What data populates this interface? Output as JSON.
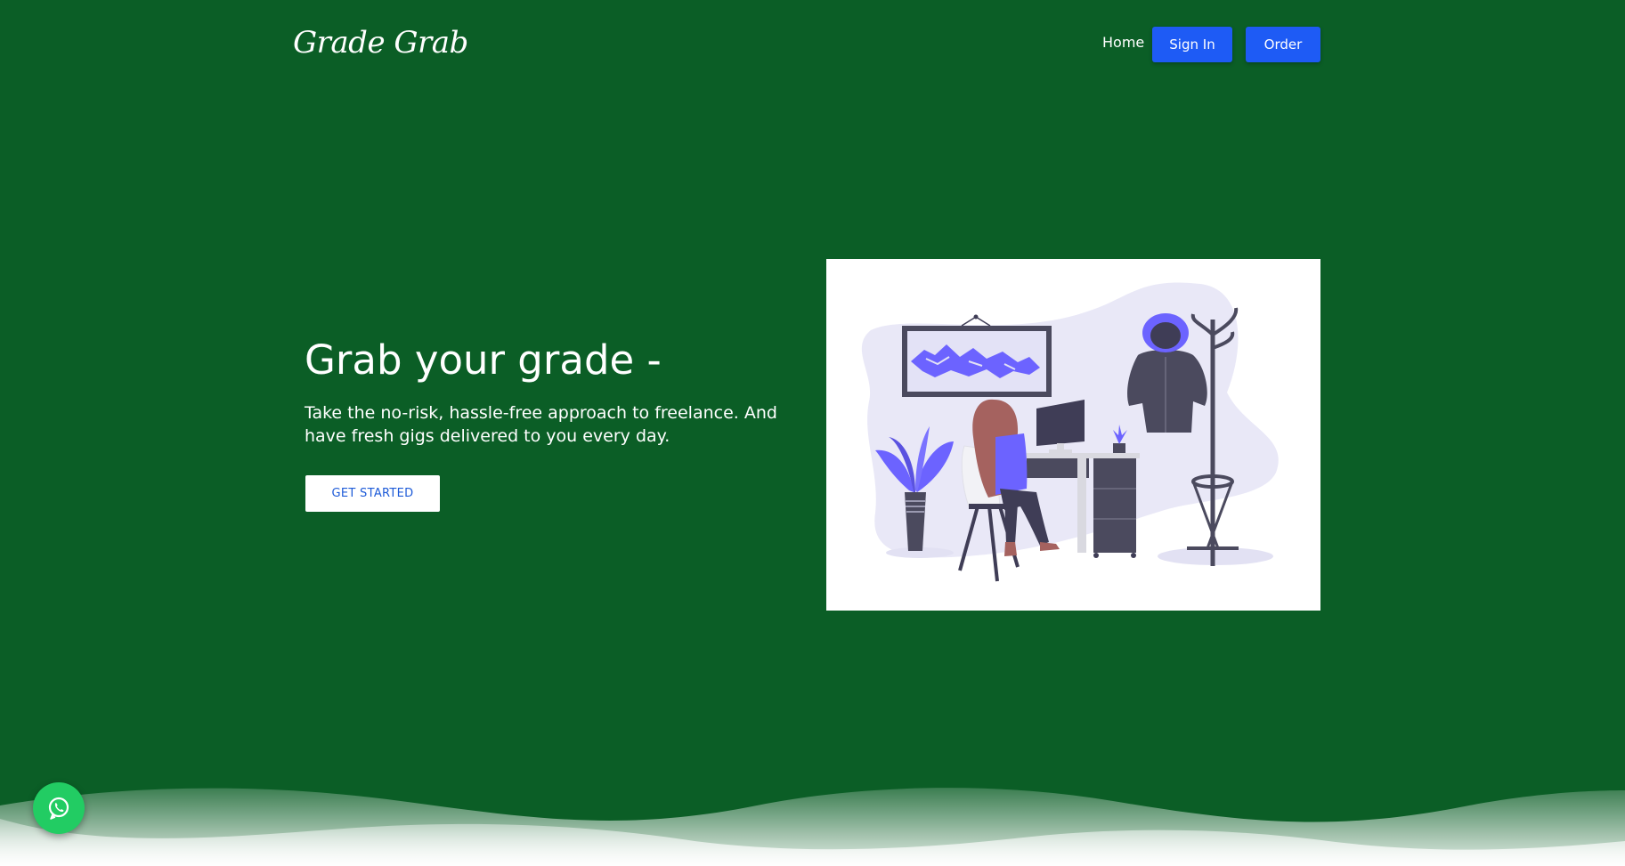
{
  "header": {
    "logo_text": "Grade Grab",
    "nav": {
      "home_label": "Home",
      "signin_label": "Sign In",
      "order_label": "Order"
    }
  },
  "hero": {
    "title": "Grab your grade -",
    "subtitle": "Take the no-risk, hassle-free approach to freelance. And have fresh gigs delivered to you every day.",
    "cta_label": "GET STARTED"
  },
  "illustration": {
    "icon": "woman-working-at-desk-illustration"
  },
  "floating": {
    "icon": "whatsapp-icon"
  },
  "colors": {
    "background": "#0b5e26",
    "primary_button": "#1e5bf5",
    "cta_text": "#1e5bd8",
    "accent_purple": "#6c63ff",
    "whatsapp_green": "#22cc63"
  }
}
